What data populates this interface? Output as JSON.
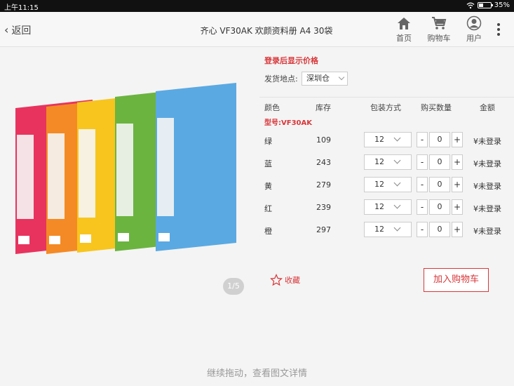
{
  "status": {
    "time": "上午11:15",
    "battery": "35%",
    "battery_level": 0.35
  },
  "header": {
    "back_label": "返回",
    "title": "齐心 VF30AK 欢颜资料册 A4 30袋",
    "nav": [
      {
        "label": "首页",
        "icon": "home-icon"
      },
      {
        "label": "购物车",
        "icon": "cart-icon"
      },
      {
        "label": "用户",
        "icon": "user-icon"
      }
    ]
  },
  "gallery": {
    "pager": "1/5",
    "folder_colors": [
      "#e8335e",
      "#f48a25",
      "#f7c51e",
      "#6bb43f",
      "#5aa9e2"
    ]
  },
  "product": {
    "price_login": "登录后显示价格",
    "ship_label": "发货地点:",
    "warehouse": "深圳仓",
    "columns": [
      "颜色",
      "库存",
      "包装方式",
      "购买数量",
      "金额"
    ],
    "model": "型号:VF30AK",
    "rows": [
      {
        "color": "绿",
        "stock": "109",
        "pack": "12",
        "qty": "0",
        "amount": "¥未登录"
      },
      {
        "color": "蓝",
        "stock": "243",
        "pack": "12",
        "qty": "0",
        "amount": "¥未登录"
      },
      {
        "color": "黄",
        "stock": "279",
        "pack": "12",
        "qty": "0",
        "amount": "¥未登录"
      },
      {
        "color": "红",
        "stock": "239",
        "pack": "12",
        "qty": "0",
        "amount": "¥未登录"
      },
      {
        "color": "橙",
        "stock": "297",
        "pack": "12",
        "qty": "0",
        "amount": "¥未登录"
      }
    ],
    "minus": "-",
    "plus": "+"
  },
  "actions": {
    "favorite": "收藏",
    "add_to_cart": "加入购物车"
  },
  "footer": {
    "drag_hint": "继续拖动，查看图文详情"
  },
  "colors": {
    "accent": "#d8373a"
  }
}
